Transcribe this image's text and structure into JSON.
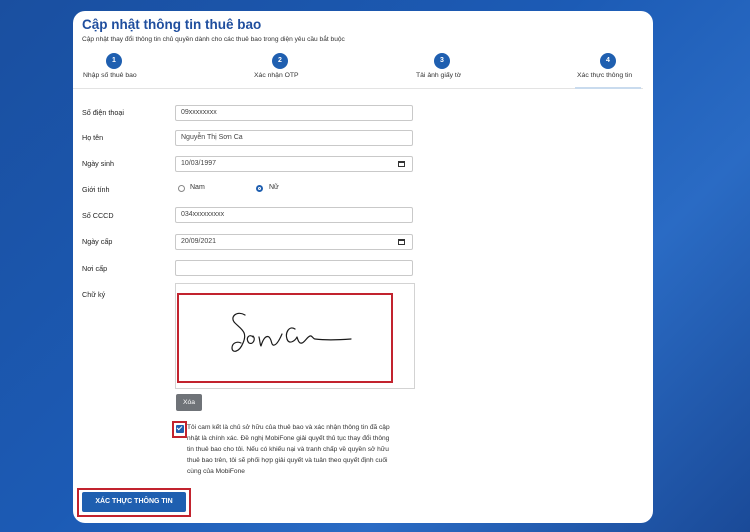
{
  "form": {
    "title": "Cập nhật thông tin thuê bao",
    "subtitle": "Cập nhật thay đổi thông tin chủ quyền dành cho các thuê bao trong diện yêu cầu bắt buộc"
  },
  "steps": [
    {
      "number": "1",
      "label": "Nhập số thuê bao"
    },
    {
      "number": "2",
      "label": "Xác nhận OTP"
    },
    {
      "number": "3",
      "label": "Tải ảnh giấy tờ"
    },
    {
      "number": "4",
      "label": "Xác thực thông tin"
    }
  ],
  "fields": {
    "phone": {
      "label": "Số điện thoại",
      "value": "09xxxxxxxx"
    },
    "name": {
      "label": "Họ tên",
      "value": "Nguyễn Thị Sơn Ca"
    },
    "dob": {
      "label": "Ngày sinh",
      "value": "10/03/1997"
    },
    "gender": {
      "label": "Giới tính",
      "options": [
        "Nam",
        "Nữ"
      ],
      "selected": "Nữ"
    },
    "cccd": {
      "label": "Số CCCD",
      "value": "034xxxxxxxxx"
    },
    "issue_date": {
      "label": "Ngày cấp",
      "value": "20/09/2021"
    },
    "issue_place": {
      "label": "Nơi cấp",
      "value": ""
    },
    "signature": {
      "label": "Chữ ký",
      "signed_text": "Son Ca"
    }
  },
  "buttons": {
    "clear": "Xóa",
    "submit": "XÁC THỰC THÔNG TIN"
  },
  "commitment": {
    "checked": true,
    "text": "Tôi cam kết là chủ sở hữu của thuê bao và xác nhận thông tin đã cập nhật là chính xác. Đề nghị MobiFone giải quyết thủ tục thay đổi thông tin thuê bao cho tôi. Nếu có khiếu nại và tranh chấp về quyền sở hữu thuê bao trên, tôi sẽ phối hợp giải quyết và tuân theo quyết định cuối cùng của MobiFone"
  },
  "colors": {
    "brand": "#1f5fb0",
    "highlight": "#c2232e",
    "background": "#1c5bb5"
  }
}
